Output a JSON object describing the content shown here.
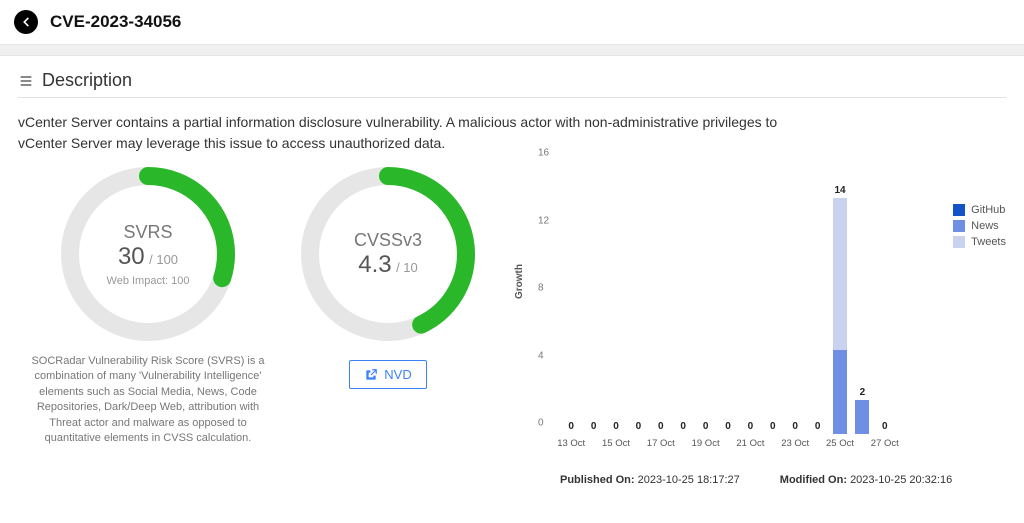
{
  "header": {
    "title": "CVE-2023-34056"
  },
  "section": {
    "title": "Description"
  },
  "description": "vCenter Server contains a partial information disclosure vulnerability. A malicious actor with non-administrative privileges to vCenter Server may leverage this issue to access unauthorized data.",
  "svrs": {
    "label": "SVRS",
    "value": "30",
    "max": "/ 100",
    "sub": "Web Impact: 100",
    "desc": "SOCRadar Vulnerability Risk Score (SVRS) is a combination of many 'Vulnerability Intelligence' elements such as Social Media, News, Code Repositories, Dark/Deep Web, attribution with Threat actor and malware as opposed to quantitative elements in CVSS calculation.",
    "percent": 30
  },
  "cvss": {
    "label": "CVSSv3",
    "value": "4.3",
    "max": "/ 10",
    "nvd_label": "NVD",
    "percent": 43
  },
  "chart_data": {
    "type": "bar",
    "title": "",
    "ylabel": "Growth",
    "xlabel": "",
    "ylim": [
      0,
      16
    ],
    "yticks": [
      0,
      4,
      8,
      12,
      16
    ],
    "categories": [
      "13 Oct",
      "14 Oct",
      "15 Oct",
      "16 Oct",
      "17 Oct",
      "18 Oct",
      "19 Oct",
      "20 Oct",
      "21 Oct",
      "22 Oct",
      "23 Oct",
      "24 Oct",
      "25 Oct",
      "26 Oct",
      "27 Oct"
    ],
    "xtick_labels": [
      "13 Oct",
      "15 Oct",
      "17 Oct",
      "19 Oct",
      "21 Oct",
      "23 Oct",
      "25 Oct",
      "27 Oct"
    ],
    "series": [
      {
        "name": "GitHub",
        "color": "#1452c8",
        "values": [
          0,
          0,
          0,
          0,
          0,
          0,
          0,
          0,
          0,
          0,
          0,
          0,
          0,
          0,
          0
        ]
      },
      {
        "name": "News",
        "color": "#6e8fe3",
        "values": [
          0,
          0,
          0,
          0,
          0,
          0,
          0,
          0,
          0,
          0,
          0,
          0,
          5,
          2,
          0
        ]
      },
      {
        "name": "Tweets",
        "color": "#c9d3f0",
        "values": [
          0,
          0,
          0,
          0,
          0,
          0,
          0,
          0,
          0,
          0,
          0,
          0,
          9,
          0,
          0
        ]
      }
    ],
    "totals": [
      0,
      0,
      0,
      0,
      0,
      0,
      0,
      0,
      0,
      0,
      0,
      0,
      14,
      2,
      0
    ]
  },
  "legend": {
    "github": "GitHub",
    "news": "News",
    "tweets": "Tweets"
  },
  "dates": {
    "published_label": "Published On:",
    "published": "2023-10-25 18:17:27",
    "modified_label": "Modified On:",
    "modified": "2023-10-25 20:32:16"
  }
}
